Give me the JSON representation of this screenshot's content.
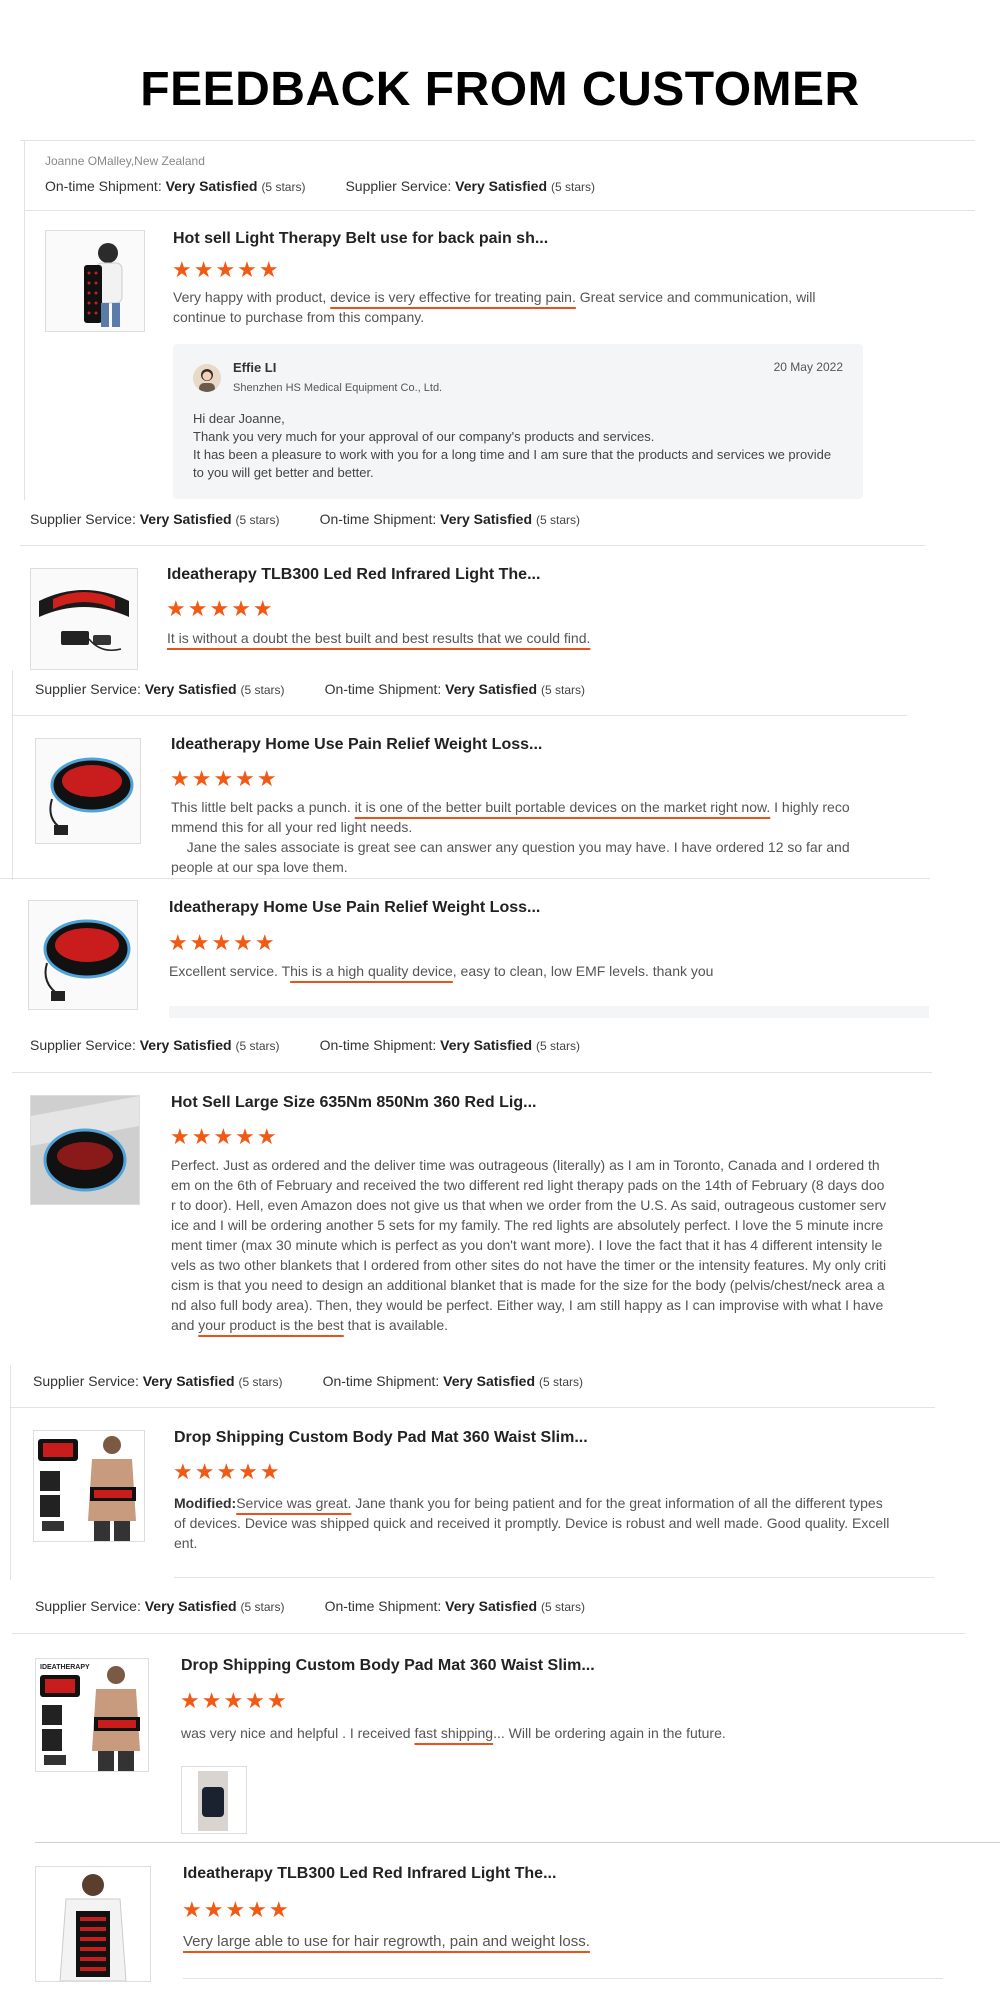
{
  "page_title": "FEEDBACK FROM CUSTOMER",
  "stars": "★★★★★",
  "accent_color": "#f05a14",
  "labels": {
    "ontime": "On-time Shipment:",
    "supplier": "Supplier Service:",
    "very_satisfied": "Very Satisfied",
    "five_stars": "(5 stars)"
  },
  "reviews": [
    {
      "reviewer": "Joanne OMalley,New Zealand",
      "title": "Hot sell Light Therapy Belt use for back pain sh...",
      "text_pre": "Very happy with product, ",
      "text_hl": "device is very effective for treating pain.",
      "text_post": " Great service and communication, will continue to purchase from this company.",
      "reply": {
        "name": "Effie LI",
        "company": "Shenzhen HS Medical Equipment Co., Ltd.",
        "date": "20 May 2022",
        "line1": "Hi dear Joanne,",
        "line2": "Thank you very much for your approval of our company's products and services.",
        "line3": "It has been a pleasure to work with you for a long time and I am sure that the products and services we provide to you will get better and better."
      }
    },
    {
      "title": "Ideatherapy TLB300 Led Red Infrared Light The...",
      "text_hl": "It is without a doubt the best built and best results that we could find."
    },
    {
      "title": "Ideatherapy Home Use Pain Relief Weight Loss...",
      "text_pre": "This little belt packs a punch. ",
      "text_hl": "it is one of the better built portable devices on the market right now.",
      "text_post": " I highly recommend this for all your red light needs.",
      "text_2": "Jane the sales associate is great see can answer any question you may have. I have ordered 12 so far and people at our spa love them."
    },
    {
      "title": "Ideatherapy Home Use Pain Relief Weight Loss...",
      "text_pre": "Excellent service. T",
      "text_hl": "his is a high quality device",
      "text_post": ", easy to clean, low EMF levels. thank you"
    },
    {
      "title": "Hot Sell Large Size 635Nm 850Nm 360 Red Lig...",
      "text_pre": "Perfect. Just as ordered and the deliver time was outrageous (literally) as I am in Toronto, Canada and I ordered them on the 6th of February and received the two different red light therapy pads on the 14th of February (8 days door to door). Hell, even Amazon does not give us that when we order from the U.S. As said, outrageous customer service and I will be ordering another 5 sets for my family. The red lights are absolutely perfect. I love the 5 minute increment timer (max 30 minute which is perfect as you don't want more). I love the fact that it has 4 different intensity levels as two other blankets that I ordered from other sites do not have the timer or the intensity features. My only criticism is that you need to design an additional blanket that is made for the size for the body (pelvis/chest/neck area and also full body area). Then, they would be perfect. Either way, I am still happy as I can improvise with what I have and ",
      "text_hl": "your product is the best",
      "text_post": " that is available."
    },
    {
      "title": "Drop Shipping Custom Body Pad Mat 360 Waist Slim...",
      "modified": "Modified:",
      "text_hl": "Service was great.",
      "text_post": " Jane thank you for being patient and for the great information of all the different types of devices. Device was shipped quick and received it promptly. Device is robust and well made. Good quality. Excellent."
    },
    {
      "title": "Drop Shipping Custom Body Pad Mat 360 Waist Slim...",
      "text_pre": "was very nice and helpful . I received ",
      "text_hl": "fast shipping",
      "text_post": "... Will be ordering again in the future."
    },
    {
      "title": "Ideatherapy TLB300 Led Red Infrared Light The...",
      "text_hl": "Very large able to use for hair regrowth, pain and weight loss."
    }
  ]
}
